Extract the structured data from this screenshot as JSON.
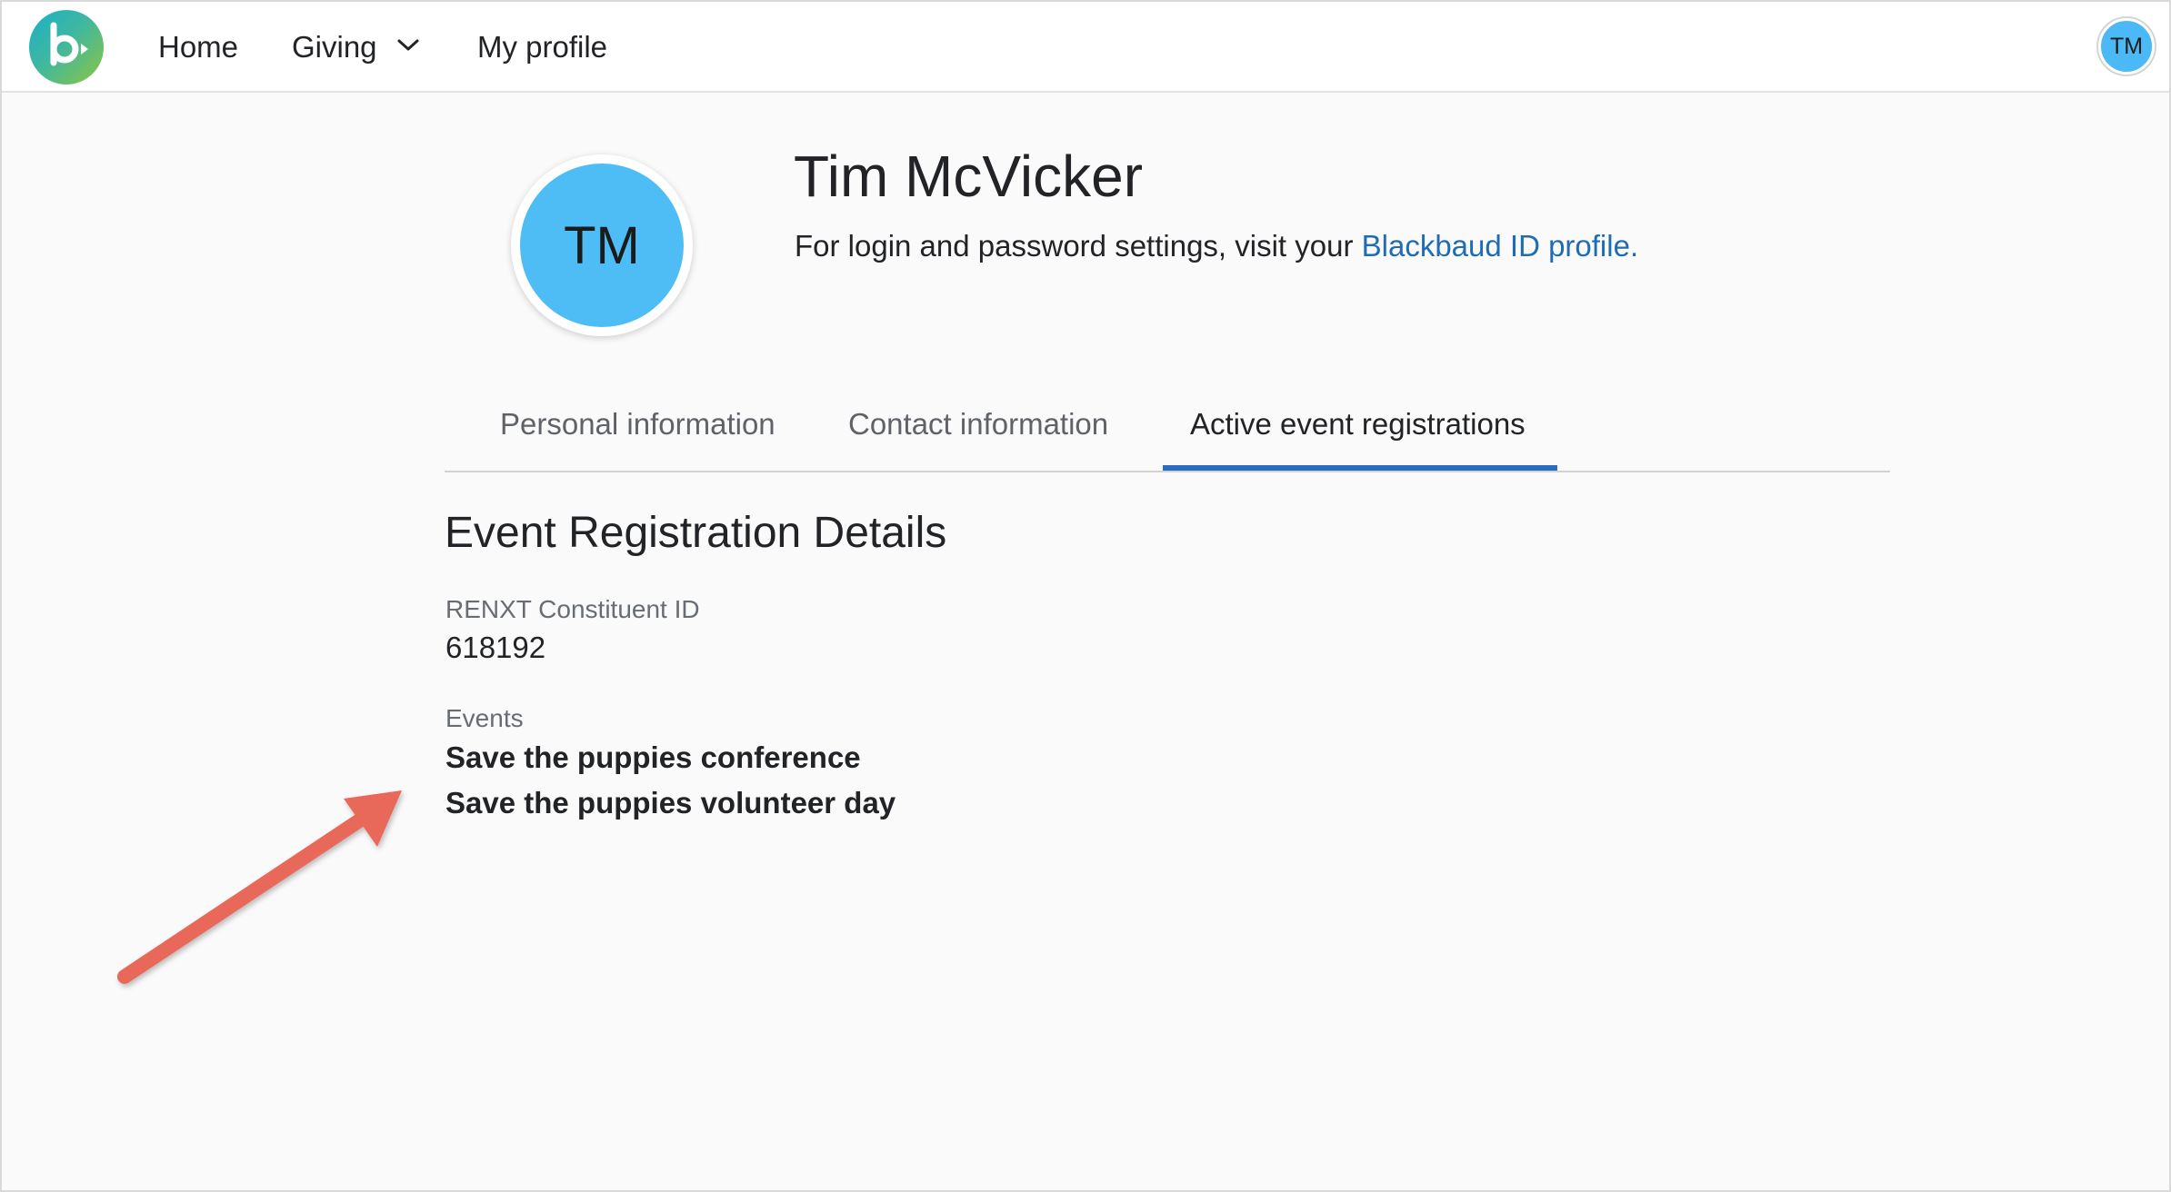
{
  "nav": {
    "home": "Home",
    "giving": "Giving",
    "my_profile": "My profile",
    "user_initials": "TM"
  },
  "profile": {
    "initials": "TM",
    "name": "Tim McVicker",
    "login_text": "For login and password settings, visit your ",
    "login_link": "Blackbaud ID profile."
  },
  "tabs": [
    {
      "label": "Personal information",
      "active": false
    },
    {
      "label": "Contact information",
      "active": false
    },
    {
      "label": "Active event registrations",
      "active": true
    }
  ],
  "details": {
    "title": "Event Registration Details",
    "constituent_id_label": "RENXT Constituent ID",
    "constituent_id": "618192",
    "events_label": "Events",
    "events": [
      "Save the puppies conference",
      "Save the puppies volunteer day"
    ]
  },
  "colors": {
    "accent": "#2a6cc0",
    "link": "#1f6cb4",
    "avatar": "#4ebdf6",
    "annotation_arrow": "#e8695a"
  },
  "icons": {
    "logo": "blackbaud-logo-icon",
    "giving_dropdown": "chevron-down-icon",
    "annotation": "arrow-annotation-icon"
  }
}
